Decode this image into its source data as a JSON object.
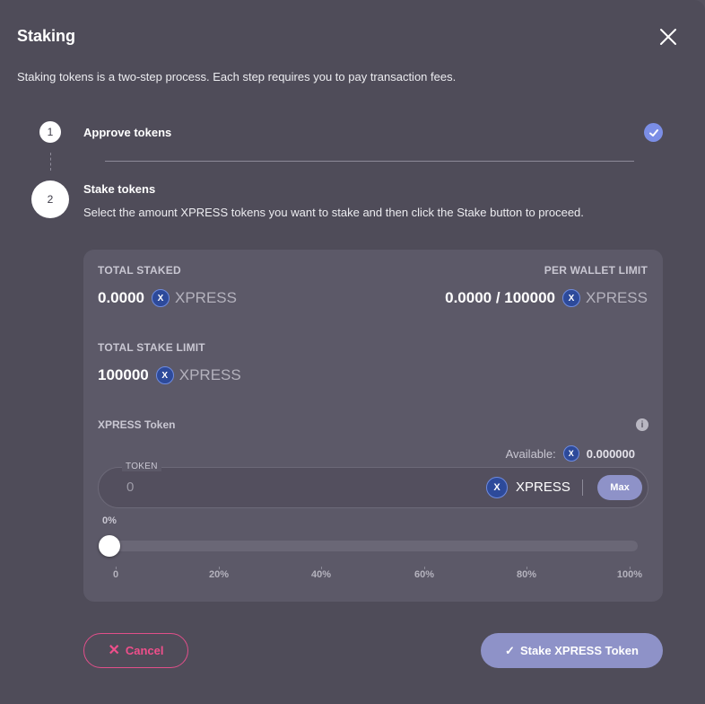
{
  "dialog": {
    "title": "Staking",
    "intro": "Staking tokens is a two-step process. Each step requires you to pay transaction fees."
  },
  "steps": [
    {
      "number": "1",
      "label": "Approve tokens",
      "completed": true
    },
    {
      "number": "2",
      "label": "Stake tokens",
      "description": "Select the amount XPRESS tokens you want to stake and then click the Stake button to proceed."
    }
  ],
  "stats": {
    "total_staked": {
      "label": "TOTAL STAKED",
      "value": "0.0000",
      "token": "XPRESS"
    },
    "per_wallet_limit": {
      "label": "PER WALLET LIMIT",
      "value": "0.0000 / 100000",
      "token": "XPRESS"
    },
    "total_stake_limit": {
      "label": "TOTAL STAKE LIMIT",
      "value": "100000",
      "token": "XPRESS"
    }
  },
  "token_field": {
    "label": "XPRESS Token",
    "available_label": "Available:",
    "available_value": "0.000000",
    "legend": "TOKEN",
    "value": "0",
    "symbol": "XPRESS",
    "max_label": "Max"
  },
  "slider": {
    "current_label": "0%",
    "value_percent": 0,
    "ticks": [
      "0",
      "20%",
      "40%",
      "60%",
      "80%",
      "100%"
    ]
  },
  "actions": {
    "cancel_label": "Cancel",
    "stake_label": "Stake XPRESS Token"
  },
  "colors": {
    "accent": "#8e92c8",
    "cancel": "#ef4f8b",
    "check": "#7b8ee6"
  },
  "icons": {
    "close": "close-icon",
    "check": "check-icon",
    "coin": "xpress-coin-icon",
    "info": "info-icon"
  }
}
